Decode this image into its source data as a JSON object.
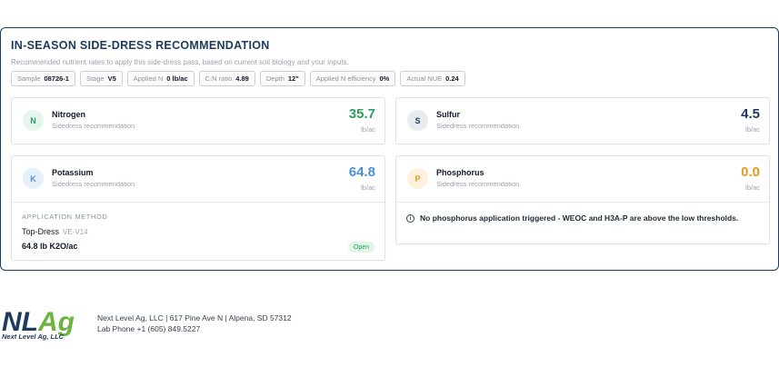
{
  "panel": {
    "title": "IN-SEASON SIDE-DRESS RECOMMENDATION",
    "subtitle": "Recommended nutrient rates to apply this side-dress pass, based on current soil biology and your inputs."
  },
  "chips": [
    {
      "key": "Sample",
      "value": "08726-1"
    },
    {
      "key": "Stage",
      "value": "V5"
    },
    {
      "key": "Applied N",
      "value": "0 lb/ac"
    },
    {
      "key": "C:N ratio",
      "value": "4.89"
    },
    {
      "key": "Depth",
      "value": "12\""
    },
    {
      "key": "Applied N efficiency",
      "value": "0%"
    },
    {
      "key": "Actual NUE",
      "value": "0.24"
    }
  ],
  "nutrients": {
    "nitrogen": {
      "letter": "N",
      "name": "Nitrogen",
      "sub": "Sidedress recommendation",
      "value": "35.7",
      "unit": "lb/ac",
      "color": "#2e9e5b",
      "badge_bg": "#e6f5ec"
    },
    "sulfur": {
      "letter": "S",
      "name": "Sulfur",
      "sub": "Sidedress recommendation",
      "value": "4.5",
      "unit": "lb/ac",
      "color": "#1e3a5f",
      "badge_bg": "#e8ecf1"
    },
    "potassium": {
      "letter": "K",
      "name": "Potassium",
      "sub": "Sidedress recommendation",
      "value": "64.8",
      "unit": "lb/ac",
      "color": "#4a90d9",
      "badge_bg": "#e6f0fb"
    },
    "phosphorus": {
      "letter": "P",
      "name": "Phosphorus",
      "sub": "Sidedress recommendation",
      "value": "0.0",
      "unit": "lb/ac",
      "color": "#e39a1c",
      "badge_bg": "#fdf1de"
    }
  },
  "potassium_application": {
    "label": "APPLICATION METHOD",
    "method": "Top-Dress",
    "stage": "VE-V14",
    "rate": "64.8 lb K2O/ac",
    "status": "Open"
  },
  "phosphorus_note": {
    "icon": "info-icon",
    "text": "No phosphorus application triggered - WEOC and H3A-P are above the low thresholds."
  },
  "footer": {
    "logo_text": "NLAg",
    "logo_tagline": "Next Level Ag, LLC",
    "address": "Next Level Ag, LLC | 617 Pine Ave N | Alpena, SD 57312",
    "phone": "Lab Phone +1 (605) 849.5227"
  },
  "colors": {
    "brand_navy": "#1e3a5f",
    "brand_green": "#6cb33f"
  }
}
